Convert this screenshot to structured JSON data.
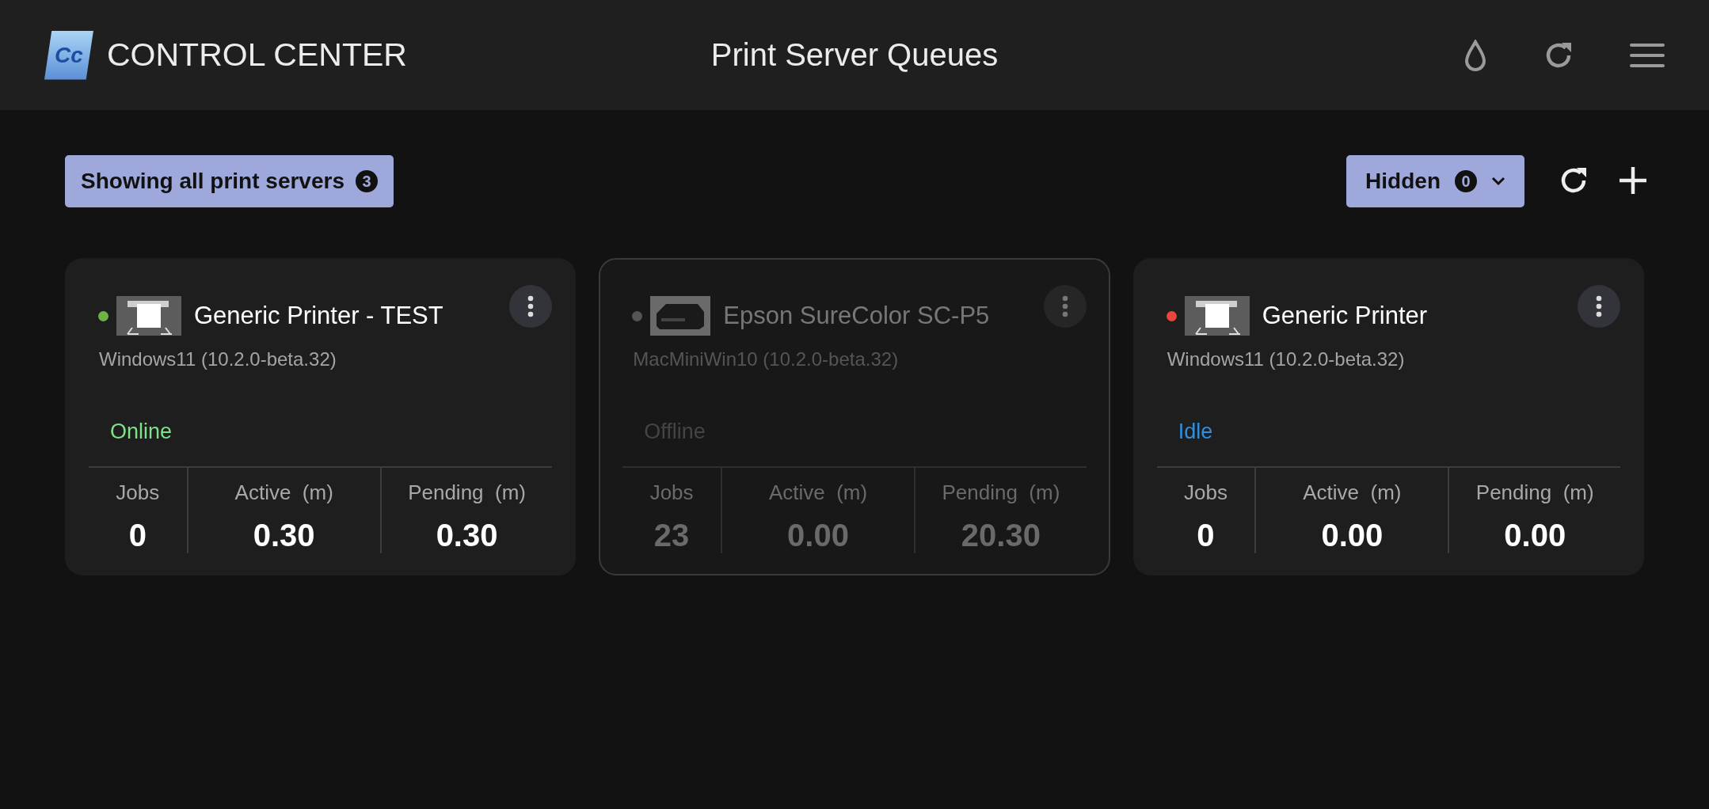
{
  "header": {
    "logo_text": "Cc",
    "app_name": "CONTROL CENTER",
    "title": "Print Server Queues"
  },
  "toolbar": {
    "filter": {
      "label": "Showing all print servers",
      "count": "3"
    },
    "hidden": {
      "label": "Hidden",
      "count": "0"
    }
  },
  "servers": [
    {
      "name": "Generic Printer - TEST",
      "host": "Windows11 (10.2.0-beta.32)",
      "kind": "plotter",
      "color": "#6db33f",
      "status": {
        "label": "Online",
        "color": "#7ee08a"
      },
      "disabled": false,
      "stats": [
        {
          "label": "Jobs",
          "value": "0"
        },
        {
          "label": "Active",
          "unit": "(m)",
          "value": "0.30"
        },
        {
          "label": "Pending",
          "unit": "(m)",
          "value": "0.30"
        }
      ]
    },
    {
      "name": "Epson SureColor SC-P5",
      "host": "MacMiniWin10 (10.2.0-beta.32)",
      "kind": "desktop",
      "color": "#555555",
      "status": {
        "label": "Offline",
        "color": "#444444"
      },
      "disabled": true,
      "stats": [
        {
          "label": "Jobs",
          "value": "23"
        },
        {
          "label": "Active",
          "unit": "(m)",
          "value": "0.00"
        },
        {
          "label": "Pending",
          "unit": "(m)",
          "value": "20.30"
        }
      ]
    },
    {
      "name": "Generic Printer",
      "host": "Windows11 (10.2.0-beta.32)",
      "kind": "plotter",
      "color": "#e8453c",
      "status": {
        "label": "Idle",
        "color": "#2f8fe0"
      },
      "disabled": false,
      "stats": [
        {
          "label": "Jobs",
          "value": "0"
        },
        {
          "label": "Active",
          "unit": "(m)",
          "value": "0.00"
        },
        {
          "label": "Pending",
          "unit": "(m)",
          "value": "0.00"
        }
      ]
    }
  ]
}
